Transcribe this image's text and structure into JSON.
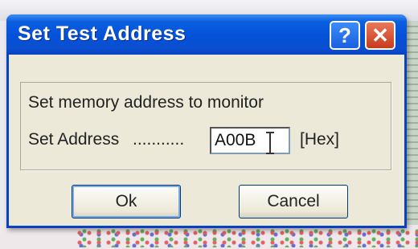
{
  "dialog": {
    "title": "Set Test Address",
    "help_label": "?",
    "close_label": "✕",
    "description": "Set memory address to monitor",
    "address_label": "Set Address",
    "address_dots": "...........",
    "address_value": "A00B",
    "unit": "[Hex]",
    "ok_label": "Ok",
    "cancel_label": "Cancel"
  }
}
